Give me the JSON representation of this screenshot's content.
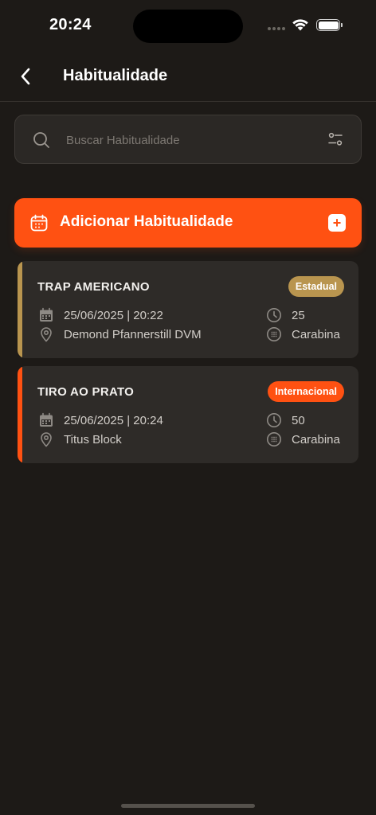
{
  "status_bar": {
    "time": "20:24"
  },
  "header": {
    "title": "Habitualidade"
  },
  "search": {
    "placeholder": "Buscar Habitualidade",
    "value": ""
  },
  "add_button": {
    "label": "Adicionar Habitualidade"
  },
  "colors": {
    "accent": "#ff5112",
    "estadual": "#b9954f",
    "background": "#1d1a17",
    "card": "#2e2b28"
  },
  "cards": [
    {
      "title": "TRAP AMERICANO",
      "badge": "Estadual",
      "badge_color": "#b9954f",
      "datetime": "25/06/2025 | 20:22",
      "location": "Demond Pfannerstill DVM",
      "count": "25",
      "weapon": "Carabina"
    },
    {
      "title": "TIRO AO PRATO",
      "badge": "Internacional",
      "badge_color": "#ff5112",
      "datetime": "25/06/2025 | 20:24",
      "location": "Titus Block",
      "count": "50",
      "weapon": "Carabina"
    }
  ]
}
